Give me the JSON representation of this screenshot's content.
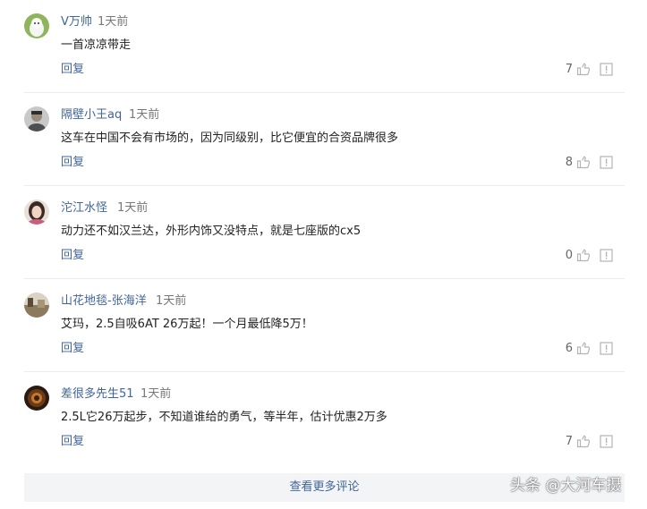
{
  "comments": [
    {
      "username": "V万帅",
      "time": "1天前",
      "content": "一首凉凉带走",
      "reply": "回复",
      "likes": "7",
      "avatar": "avatar-white-cat"
    },
    {
      "username": "隔壁小王aq",
      "time": "1天前",
      "content": "这车在中国不会有市场的，因为同级别，比它便宜的合资品牌很多",
      "reply": "回复",
      "likes": "8",
      "avatar": "avatar-person-gray"
    },
    {
      "username": "沱江水怪",
      "time": "1天前",
      "content": "动力还不如汉兰达，外形内饰又没特点，就是七座版的cx5",
      "reply": "回复",
      "likes": "0",
      "avatar": "avatar-woman-portrait"
    },
    {
      "username": "山花地毯-张海洋",
      "time": "1天前",
      "content": "艾玛，2.5自吸6AT 26万起！一个月最低降5万！",
      "reply": "回复",
      "likes": "6",
      "avatar": "avatar-landscape"
    },
    {
      "username": "差很多先生51",
      "time": "1天前",
      "content": "2.5L它26万起步，不知道谁给的勇气，等半年，估计优惠2万多",
      "reply": "回复",
      "likes": "7",
      "avatar": "avatar-dark-emblem"
    }
  ],
  "more_button": "查看更多评论",
  "watermark": "头条 @大河车摄",
  "icons": {
    "like": "thumbs-up-icon",
    "report": "report-icon"
  },
  "colors": {
    "link": "#406599",
    "text": "#222222",
    "muted": "#777777",
    "divider": "#ececec",
    "more_bg": "#f3f4f6"
  }
}
